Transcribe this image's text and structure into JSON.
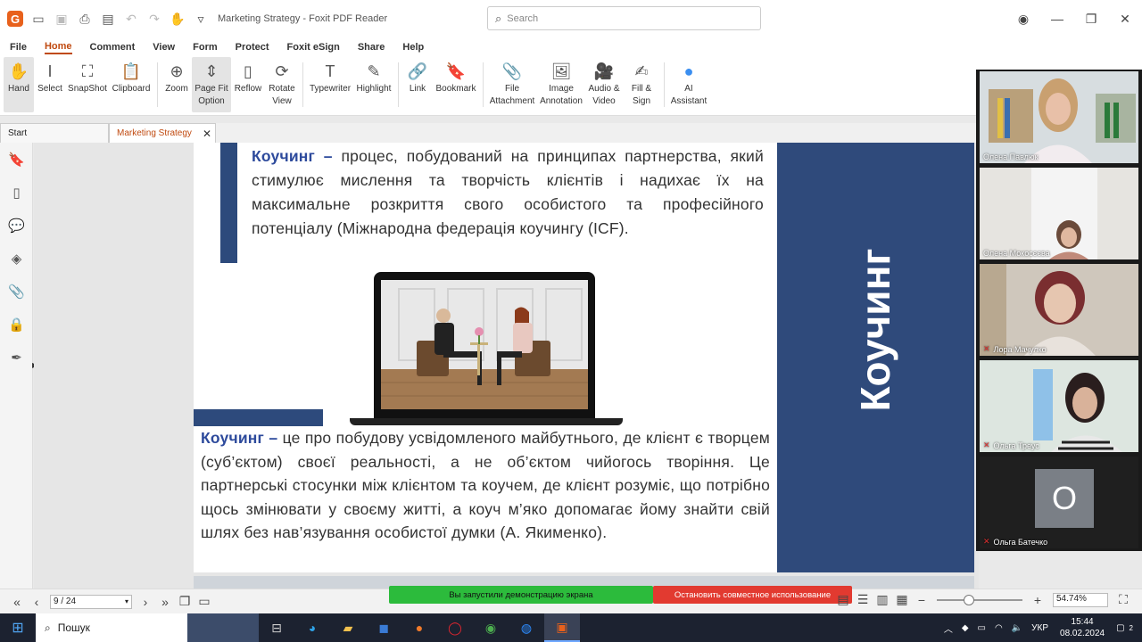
{
  "app": {
    "title": "Marketing Strategy - Foxit PDF Reader",
    "search_placeholder": "Search"
  },
  "menu": [
    "File",
    "Home",
    "Comment",
    "View",
    "Form",
    "Protect",
    "Foxit eSign",
    "Share",
    "Help"
  ],
  "ribbon": [
    {
      "label": "Hand",
      "icon": "hand-icon"
    },
    {
      "label": "Select",
      "icon": "select-icon"
    },
    {
      "label": "SnapShot",
      "icon": "snapshot-icon"
    },
    {
      "label": "Clipboard",
      "icon": "clipboard-icon"
    },
    {
      "label": "Zoom",
      "icon": "zoom-icon"
    },
    {
      "label": "Page Fit Option",
      "icon": "page-fit-icon"
    },
    {
      "label": "Reflow",
      "icon": "reflow-icon"
    },
    {
      "label": "Rotate View",
      "icon": "rotate-icon"
    },
    {
      "label": "Typewriter",
      "icon": "typewriter-icon"
    },
    {
      "label": "Highlight",
      "icon": "highlight-icon"
    },
    {
      "label": "Link",
      "icon": "link-icon"
    },
    {
      "label": "Bookmark",
      "icon": "bookmark-icon"
    },
    {
      "label": "File Attachment",
      "icon": "attachment-icon"
    },
    {
      "label": "Image Annotation",
      "icon": "image-icon"
    },
    {
      "label": "Audio & Video",
      "icon": "video-icon"
    },
    {
      "label": "Fill & Sign",
      "icon": "sign-icon"
    },
    {
      "label": "AI Assistant",
      "icon": "ai-icon"
    }
  ],
  "tabs": {
    "start": "Start",
    "doc": "Marketing Strategy"
  },
  "document": {
    "para1_term": "Коучинг –",
    "para1_rest": " процес, побудований на принципах партнерства, який стимулює мислення та творчість клієнтів і надихає їх на максимальне розкриття свого особистого та професійного потенціалу (Міжнародна федерація коучингу (ICF).",
    "para2_term": "Коучинг –",
    "para2_rest": " це про побудову усвідомленого майбутнього, де клієнт є творцем (суб’єктом) своєї реальності, а не об’єктом чийогось творіння. Це партнерські стосунки між клієнтом та коучем, де клієнт розуміє, що потрібно щось змінювати у своєму житті, а коуч м’яко допомагає йому знайти свій шлях без нав’язування особистої думки (А. Якименко).",
    "side_title": "Коучинг"
  },
  "participants": [
    {
      "name": "Олена Павлюк",
      "muted": false
    },
    {
      "name": "Олена Мокосєєва",
      "muted": false
    },
    {
      "name": "Лора Мачулко",
      "muted": true
    },
    {
      "name": "Ольга Треус",
      "muted": true
    },
    {
      "name": "Ольга Батечко",
      "muted": true,
      "avatar": "O"
    }
  ],
  "status": {
    "page": "9 / 24",
    "zoom": "54.74%",
    "share_notice": "Вы запустили демонстрацию экрана",
    "stop_share": "Остановить совместное использование"
  },
  "taskbar": {
    "search": "Пошук",
    "lang": "УКР",
    "time": "15:44",
    "date": "08.02.2024",
    "notif": "2"
  },
  "colors": {
    "accent": "#c04a10",
    "doc_blue": "#2f4a7b",
    "share_green": "#2cbb3c",
    "share_red": "#e23a30"
  }
}
